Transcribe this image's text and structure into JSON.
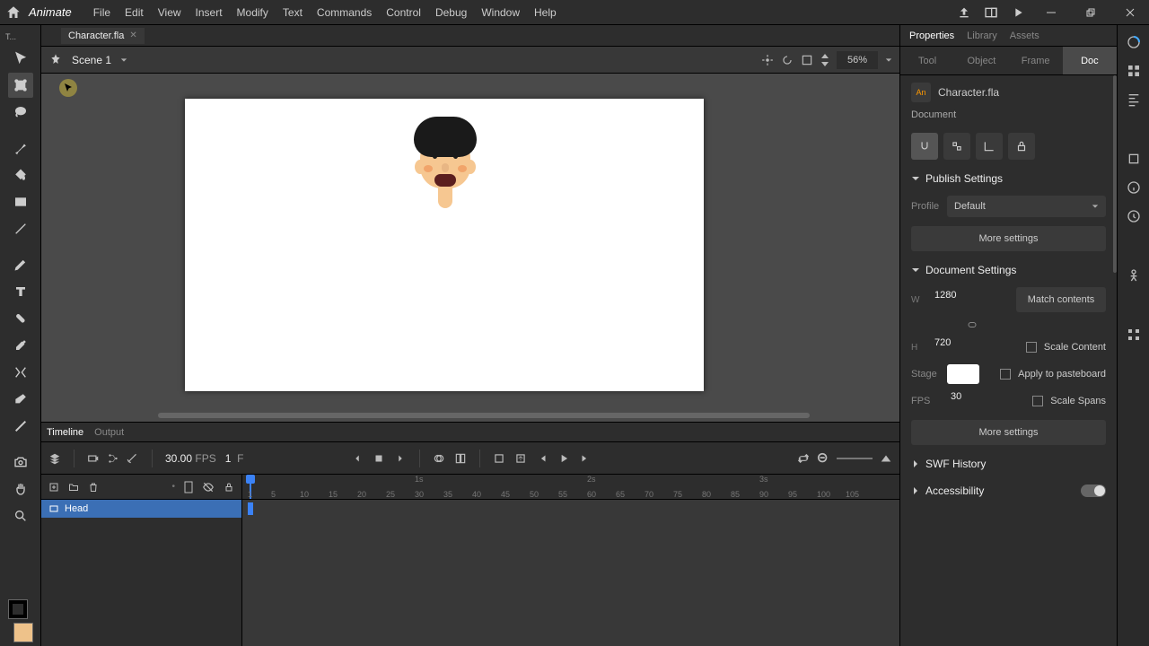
{
  "app": {
    "title": "Animate"
  },
  "menu": [
    "File",
    "Edit",
    "View",
    "Insert",
    "Modify",
    "Text",
    "Commands",
    "Control",
    "Debug",
    "Window",
    "Help"
  ],
  "document": {
    "filename": "Character.fla",
    "label": "Document"
  },
  "scene": {
    "name": "Scene 1",
    "zoom": "56%"
  },
  "timeline": {
    "tabs": [
      "Timeline",
      "Output"
    ],
    "fps_value": "30.00",
    "fps_label": "FPS",
    "frame": "1",
    "frame_label": "F",
    "seconds": [
      "1s",
      "2s",
      "3s"
    ],
    "ticks": [
      "1",
      "5",
      "10",
      "15",
      "20",
      "25",
      "30",
      "35",
      "40",
      "45",
      "50",
      "55",
      "60",
      "65",
      "70",
      "75",
      "80",
      "85",
      "90",
      "95",
      "100",
      "105"
    ],
    "layer_name": "Head"
  },
  "props": {
    "tabs": [
      "Properties",
      "Library",
      "Assets"
    ],
    "subtabs": [
      "Tool",
      "Object",
      "Frame",
      "Doc"
    ],
    "publish_title": "Publish Settings",
    "profile_label": "Profile",
    "profile_value": "Default",
    "more_settings": "More settings",
    "docset_title": "Document Settings",
    "w_label": "W",
    "h_label": "H",
    "w_value": "1280",
    "h_value": "720",
    "match_contents": "Match contents",
    "stage_label": "Stage",
    "fps_label": "FPS",
    "fps_value": "30",
    "scale_content": "Scale Content",
    "apply_pasteboard": "Apply to pasteboard",
    "scale_spans": "Scale Spans",
    "swf_history": "SWF History",
    "accessibility": "Accessibility"
  }
}
